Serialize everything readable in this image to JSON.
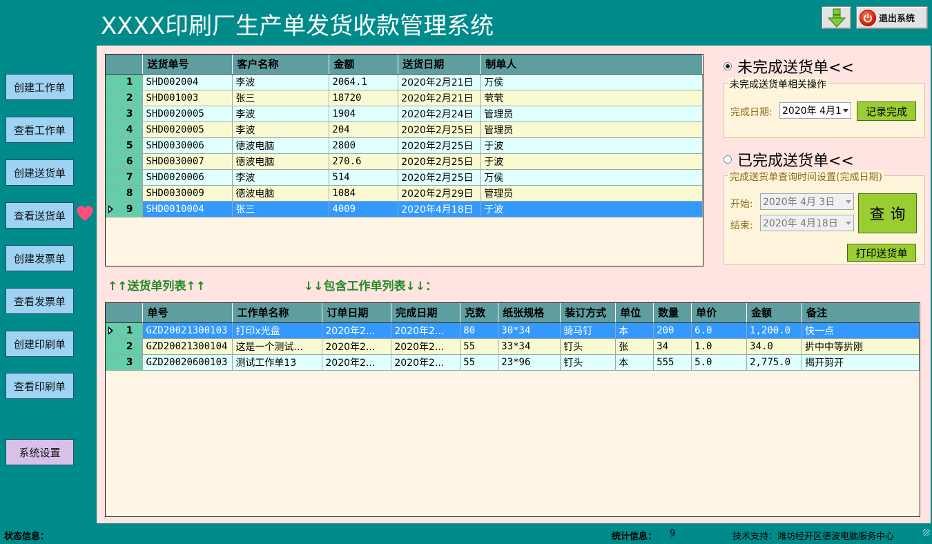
{
  "app": {
    "title": "XXXX印刷厂生产单发货收款管理系统"
  },
  "toolbar": {
    "exit_label": "退出系统"
  },
  "sidebar": {
    "items": [
      {
        "label": "创建工作单"
      },
      {
        "label": "查看工作单"
      },
      {
        "label": "创建送货单"
      },
      {
        "label": "查看送货单"
      },
      {
        "label": "创建发票单"
      },
      {
        "label": "查看发票单"
      },
      {
        "label": "创建印刷单"
      },
      {
        "label": "查看印刷单"
      }
    ],
    "settings_label": "系统设置"
  },
  "delivery_grid": {
    "columns": [
      "送货单号",
      "客户名称",
      "金额",
      "送货日期",
      "制单人"
    ],
    "rows": [
      {
        "n": "1",
        "id": "SHD002004",
        "customer": "李波",
        "amount": "2064.1",
        "date": "2020年2月21日",
        "maker": "万侯"
      },
      {
        "n": "2",
        "id": "SHD001003",
        "customer": "张三",
        "amount": "18720",
        "date": "2020年2月21日",
        "maker": "茕茕"
      },
      {
        "n": "3",
        "id": "SHD0020005",
        "customer": "李波",
        "amount": "1904",
        "date": "2020年2月24日",
        "maker": "管理员"
      },
      {
        "n": "4",
        "id": "SHD0020005",
        "customer": "李波",
        "amount": "204",
        "date": "2020年2月25日",
        "maker": "管理员"
      },
      {
        "n": "5",
        "id": "SHD0030006",
        "customer": "德波电脑",
        "amount": "2800",
        "date": "2020年2月25日",
        "maker": "于波"
      },
      {
        "n": "6",
        "id": "SHD0030007",
        "customer": "德波电脑",
        "amount": "270.6",
        "date": "2020年2月25日",
        "maker": "于波"
      },
      {
        "n": "7",
        "id": "SHD0020006",
        "customer": "李波",
        "amount": "514",
        "date": "2020年2月25日",
        "maker": "万侯"
      },
      {
        "n": "8",
        "id": "SHD0030009",
        "customer": "德波电脑",
        "amount": "1084",
        "date": "2020年2月29日",
        "maker": "管理员"
      },
      {
        "n": "9",
        "id": "SHD0010004",
        "customer": "张三",
        "amount": "4009",
        "date": "2020年4月18日",
        "maker": "于波"
      }
    ],
    "selected_row": 8
  },
  "labels": {
    "delivery_list": "↑↑送货单列表↑↑",
    "work_list": "↓↓包含工作单列表↓↓："
  },
  "work_grid": {
    "columns": [
      "单号",
      "工作单名称",
      "订单日期",
      "完成日期",
      "克数",
      "纸张规格",
      "装订方式",
      "单位",
      "数量",
      "单价",
      "金额",
      "备注"
    ],
    "rows": [
      {
        "n": "1",
        "id": "GZD20021300103",
        "name": "打印x光盘",
        "order_date": "2020年2...",
        "finish_date": "2020年2...",
        "weight": "80",
        "paper": "30*34",
        "binding": "骑马钉",
        "unit": "本",
        "qty": "200",
        "price": "6.0",
        "amount": "1,200.0",
        "note": "快一点"
      },
      {
        "n": "2",
        "id": "GZD20021300104",
        "name": "这是一个测试...",
        "order_date": "2020年2...",
        "finish_date": "2020年2...",
        "weight": "55",
        "paper": "33*34",
        "binding": "钉头",
        "unit": "张",
        "qty": "34",
        "price": "1.0",
        "amount": "34.0",
        "note": "扸中中等扸刚"
      },
      {
        "n": "3",
        "id": "GZD20020600103",
        "name": "测试工作单13",
        "order_date": "2020年2...",
        "finish_date": "2020年2...",
        "weight": "55",
        "paper": "23*96",
        "binding": "钉头",
        "unit": "本",
        "qty": "555",
        "price": "5.0",
        "amount": "2,775.0",
        "note": "揭开剪开"
      }
    ],
    "selected_row": 0
  },
  "pending": {
    "radio_label": "未完成送货单<<",
    "selected": true,
    "group_title": "未完成送货单相关操作",
    "date_label": "完成日期:",
    "date_value": "2020年  4月1",
    "record_button": "记录完成"
  },
  "completed": {
    "radio_label": "已完成送货单<<",
    "selected": false,
    "group_title": "完成送货单查询时间设置(完成日期)",
    "start_label": "开始:",
    "start_value": "2020年  4月  3日",
    "end_label": "结束:",
    "end_value": "2020年  4月18日",
    "query_button": "查询",
    "print_button": "打印送货单"
  },
  "status": {
    "state_label": "状态信息：",
    "stats_label": "统计信息：",
    "stats_value": "9",
    "support": "技术支持：潍坊经开区德波电脑服务中心"
  },
  "colors": {
    "background": "#008b8b",
    "panel": "#ffe4e1",
    "header": "#5f9ea0",
    "row_header": "#66cdaa",
    "row_odd": "#e0ffff",
    "row_even": "#fafad2",
    "selection": "#3399ff",
    "accent_green": "#9acd32",
    "label_green": "#228b22"
  },
  "icons": {
    "download": "green-down-arrow-icon",
    "exit": "power-icon",
    "marker": "heart-icon"
  }
}
